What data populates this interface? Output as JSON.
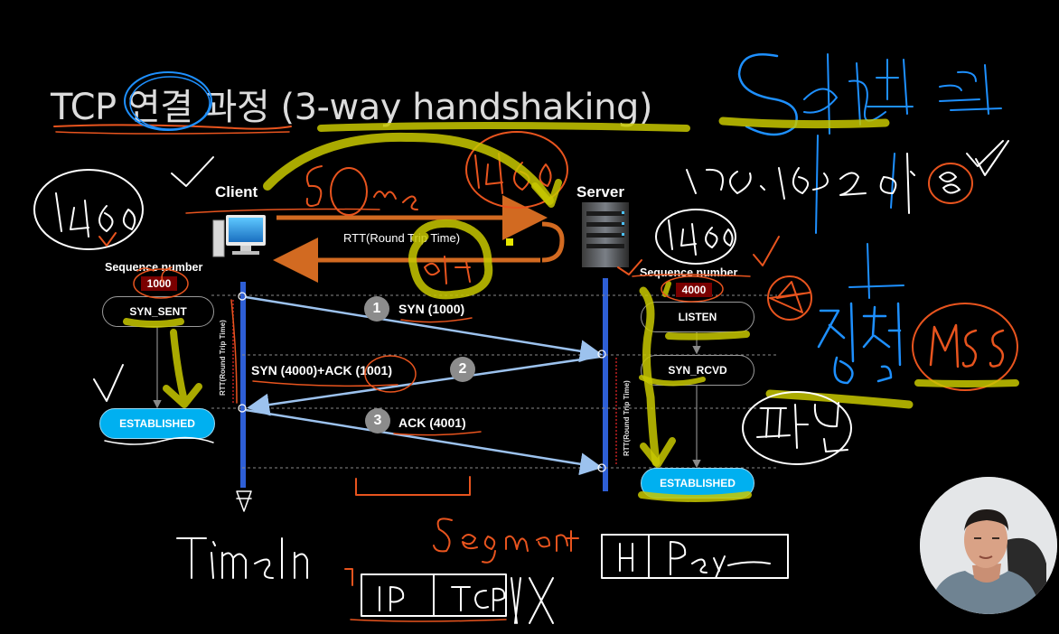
{
  "slide": {
    "title": "TCP 연결 과정 (3-way handshaking)"
  },
  "hosts": {
    "client_label": "Client",
    "server_label": "Server"
  },
  "rtt_label": "RTT(Round Trip Time)",
  "rtt_vertical_label": "RTT(Round Trip Time)",
  "client": {
    "seq_heading": "Sequence number",
    "seq_value": "1000",
    "state_initial": "SYN_SENT",
    "state_final": "ESTABLISHED"
  },
  "server": {
    "seq_heading": "Sequence number",
    "seq_value": "4000",
    "state_initial": "LISTEN",
    "state_mid": "SYN_RCVD",
    "state_final": "ESTABLISHED"
  },
  "steps": [
    {
      "number": "1",
      "label": "SYN (1000)"
    },
    {
      "number": "2",
      "label": "SYN (4000)+ACK (1001)"
    },
    {
      "number": "3",
      "label": "ACK (4001)"
    }
  ],
  "colors": {
    "background": "#000000",
    "timeline": "#2e5fd6",
    "message_arrow": "#9cc2ee",
    "rtt_arrow": "#d26a21",
    "established": "#00b0f0",
    "seq_box": "#7a0000",
    "ink_orange": "#e8541e",
    "ink_blue": "#1e90ff",
    "ink_yellow": "#c8c800",
    "ink_white": "#ffffff"
  }
}
